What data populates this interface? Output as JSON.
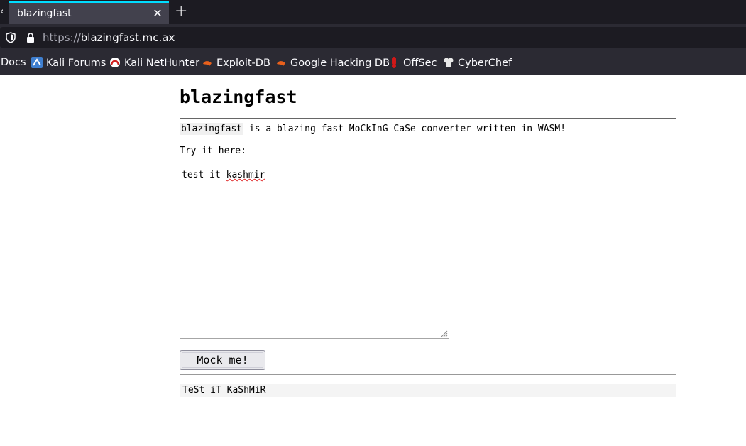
{
  "browser": {
    "tab": {
      "title": "blazingfast",
      "close": "✕",
      "scroll_left": "‹"
    },
    "new_tab": "+",
    "url": {
      "scheme": "https://",
      "host": "blazingfast.mc.ax"
    },
    "bookmarks": [
      {
        "label": "Docs",
        "icon": "none"
      },
      {
        "label": "Kali Forums",
        "icon": "kali-forums-icon"
      },
      {
        "label": "Kali NetHunter",
        "icon": "kali-nethunter-icon"
      },
      {
        "label": "Exploit-DB",
        "icon": "exploit-db-icon"
      },
      {
        "label": "Google Hacking DB",
        "icon": "exploit-db-icon"
      },
      {
        "label": "OffSec",
        "icon": "offsec-icon"
      },
      {
        "label": "CyberChef",
        "icon": "cyberchef-icon"
      }
    ]
  },
  "page": {
    "title": "blazingfast",
    "desc_code": "blazingfast",
    "desc_rest": " is a blazing fast MoCkInG CaSe converter written in WASM!",
    "try_label": "Try it here:",
    "input_before": "test it ",
    "input_misspelled": "kashmir",
    "button_label": "Mock me!",
    "output": "TeSt iT KaShMiR"
  },
  "colors": {
    "tab_accent": "#00ddff",
    "chrome_dark": "#1c1b22",
    "chrome": "#2b2a33"
  }
}
